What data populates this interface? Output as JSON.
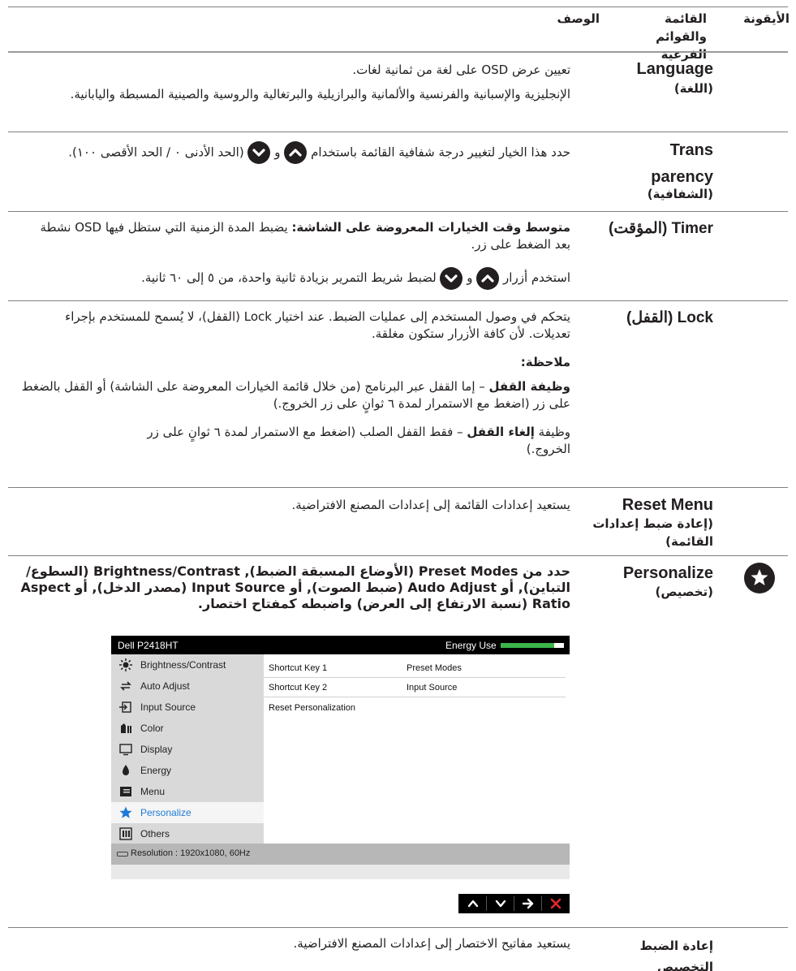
{
  "header": {
    "icon_col": "الأيقونة",
    "menu_col": "القائمة والقوائم الفرعية",
    "desc_col": "الوصف"
  },
  "rows": {
    "language": {
      "name_en": "Language",
      "name_ar": "(اللغة)",
      "p1": "تعيين عرض OSD على لغة من ثمانية لغات.",
      "p2": "الإنجليزية والإسبانية والفرنسية والألمانية والبرازيلية والبرتغالية والروسية والصينية المسبطة واليابانية."
    },
    "transparency": {
      "name_en_1": "Trans",
      "name_en_2": "parency",
      "name_ar": "(الشفافية)",
      "p1_a": "حدد هذا الخيار لتغيير درجة شفافية القائمة باستخدام",
      "p1_b": "و",
      "p1_c": "(الحد الأدنى ٠ / الحد الأقصى ١٠٠)."
    },
    "timer": {
      "name": "Timer (المؤقت)",
      "p1_bold": "متوسط وقت الخيارات المعروضة على الشاشة:",
      "p1_rest": "يضبط المدة الزمنية التي ستظل فيها OSD نشطة بعد الضغط على زر.",
      "p2_a": "استخدم أزرار",
      "p2_b": "و",
      "p2_c": "لضبط شريط التمرير بزيادة ثانية واحدة، من ٥ إلى ٦٠ ثانية."
    },
    "lock": {
      "name": "Lock (القفل)",
      "p1": "يتحكم في وصول المستخدم إلى عمليات الضبط. عند اختيار Lock (القفل)، لا يُسمح للمستخدم بإجراء تعديلات. لأن كافة الأزرار ستكون مغلقة.",
      "note": "ملاحظة:",
      "p2_bold": "وظيفة القفل",
      "p2_rest": "– إما القفل عبر البرنامج (من خلال قائمة الخيارات المعروضة على الشاشة) أو القفل بالضغط على زر (اضغط مع الاستمرار لمدة ٦ ثوانٍ على زر الخروج.)",
      "p3_pre": "وظيفة",
      "p3_bold": "إلغاء القفل",
      "p3_rest": "– فقط القفل الصلب (اضغط مع الاستمرار لمدة ٦ ثوانٍ على زر الخروج.)"
    },
    "reset_menu": {
      "name_en": "Reset Menu",
      "name_ar": "(إعادة ضبط إعدادات القائمة)",
      "p1": "يستعيد إعدادات القائمة إلى إعدادات المصنع الافتراضية."
    },
    "personalize": {
      "name_en": "Personalize",
      "name_ar": "(تخصيص)",
      "icon": "star-icon",
      "p1": "حدد من Preset Modes (الأوضاع المسبقة الضبط), Brightness/Contrast (السطوع/التباين), أو Audo Adjust (ضبط الصوت), أو Input Source (مصدر الدخل), أو Aspect Ratio (نسبة الارتفاع إلى العرض) واضبطه كمفتاح اختصار."
    },
    "reset_personal": {
      "name": "إعادة الضبط التخصيص",
      "p1": "يستعيد مفاتيح الاختصار إلى إعدادات المصنع الافتراضية."
    }
  },
  "osd": {
    "title": "Dell P2418HT",
    "energy_label": "Energy Use",
    "energy_level": 0.85,
    "menu": [
      {
        "label": "Brightness/Contrast",
        "icon": "brightness-icon"
      },
      {
        "label": "Auto Adjust",
        "icon": "auto-adjust-icon"
      },
      {
        "label": "Input Source",
        "icon": "input-source-icon"
      },
      {
        "label": "Color",
        "icon": "color-icon"
      },
      {
        "label": "Display",
        "icon": "display-icon"
      },
      {
        "label": "Energy",
        "icon": "energy-icon"
      },
      {
        "label": "Menu",
        "icon": "menu-icon"
      },
      {
        "label": "Personalize",
        "icon": "star-icon"
      },
      {
        "label": "Others",
        "icon": "others-icon"
      }
    ],
    "selected": "Personalize",
    "shortcut1_label": "Shortcut Key 1",
    "shortcut1_value": "Preset Modes",
    "shortcut2_label": "Shortcut Key 2",
    "shortcut2_value": "Input Source",
    "reset_label": "Reset Personalization",
    "resolution": "Resolution : 1920x1080, 60Hz"
  },
  "nav_buttons": [
    "up-icon",
    "down-icon",
    "right-arrow-icon",
    "close-icon"
  ],
  "colors": {
    "energy_bar": "#3cb54a",
    "selected_text": "#1e7ad6",
    "close_red": "#e3272d"
  }
}
